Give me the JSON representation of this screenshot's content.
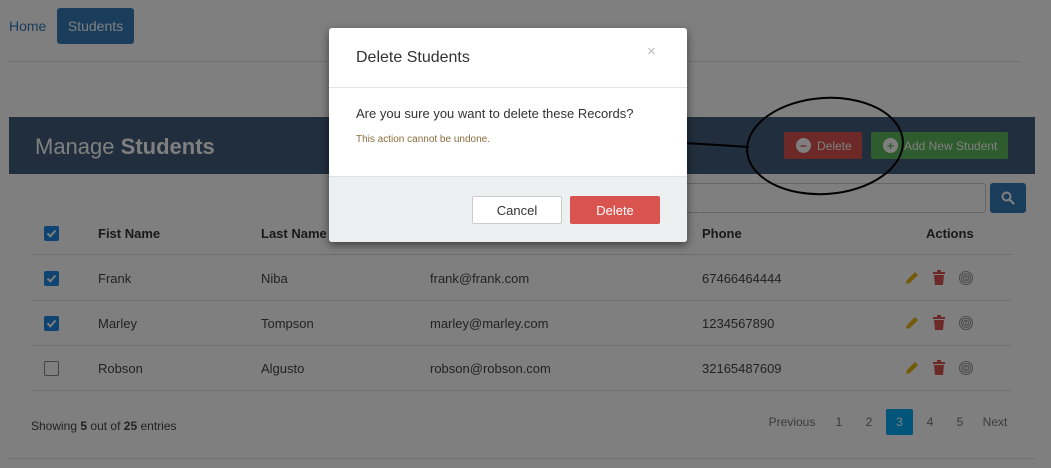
{
  "nav": {
    "home_label": "Home",
    "students_label": "Students"
  },
  "header": {
    "title_prefix": "Manage",
    "title_bold": "Students",
    "delete_label": "Delete",
    "add_label": "Add New Student"
  },
  "search": {
    "placeholder": ""
  },
  "table": {
    "columns": {
      "first_name": "Fist Name",
      "last_name": "Last Name",
      "phone": "Phone",
      "actions": "Actions"
    },
    "rows": [
      {
        "checked": true,
        "first_name": "Frank",
        "last_name": "Niba",
        "email": "frank@frank.com",
        "phone": "67466464444"
      },
      {
        "checked": true,
        "first_name": "Marley",
        "last_name": "Tompson",
        "email": "marley@marley.com",
        "phone": "1234567890"
      },
      {
        "checked": false,
        "first_name": "Robson",
        "last_name": "Algusto",
        "email": "robson@robson.com",
        "phone": "32165487609"
      }
    ]
  },
  "footer": {
    "showing_prefix": "Showing",
    "showing_count": "5",
    "showing_middle": "out of",
    "showing_total": "25",
    "showing_suffix": "entries"
  },
  "pagination": {
    "previous": "Previous",
    "pages": [
      "1",
      "2",
      "3",
      "4",
      "5"
    ],
    "active_page": "3",
    "next": "Next"
  },
  "modal": {
    "title": "Delete Students",
    "close_glyph": "×",
    "question": "Are you sure you want to delete these Records?",
    "warning": "This action cannot be undone.",
    "cancel_label": "Cancel",
    "confirm_label": "Delete"
  },
  "colors": {
    "header_bg": "#435d7d",
    "danger": "#d9534f",
    "success": "#5cb85c",
    "primary": "#337ab7",
    "checkbox": "#1e88e5",
    "edit_icon": "#e8b715",
    "active_page": "#03a9f4"
  },
  "icons": {
    "delete_button": "minus-circle-icon",
    "add_button": "plus-circle-icon",
    "search": "search-icon",
    "row_actions": [
      "pencil-icon",
      "trash-icon",
      "fingerprint-icon"
    ]
  }
}
